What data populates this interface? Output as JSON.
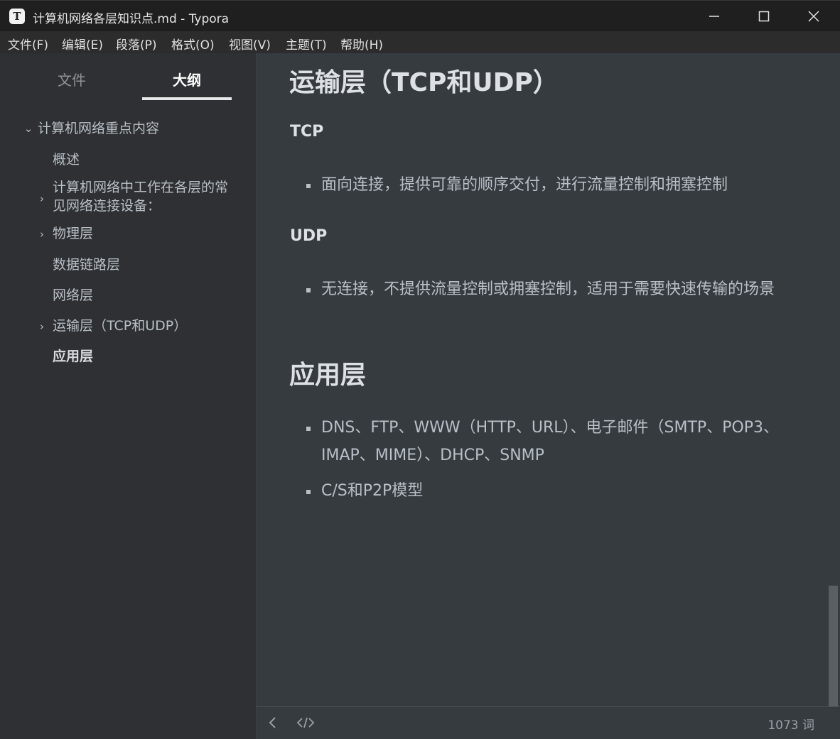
{
  "window": {
    "title": "计算机网络各层知识点.md - Typora",
    "app_icon_letter": "T"
  },
  "menu": [
    "文件(F)",
    "编辑(E)",
    "段落(P)",
    "格式(O)",
    "视图(V)",
    "主题(T)",
    "帮助(H)"
  ],
  "sidebar": {
    "tabs": [
      "文件",
      "大纲"
    ],
    "active_tab": "大纲",
    "outline": [
      {
        "label": "计算机网络重点内容",
        "expander": "expanded"
      },
      {
        "label": "概述",
        "expander": "none"
      },
      {
        "label": "计算机网络中工作在各层的常见网络连接设备：",
        "expander": "collapsed"
      },
      {
        "label": "物理层",
        "expander": "collapsed"
      },
      {
        "label": "数据链路层",
        "expander": "none"
      },
      {
        "label": "网络层",
        "expander": "none"
      },
      {
        "label": "运输层（TCP和UDP）",
        "expander": "collapsed"
      },
      {
        "label": "应用层",
        "expander": "none",
        "active": true
      }
    ]
  },
  "document": {
    "h1_transport": "运输层（TCP和UDP）",
    "h3_tcp": "TCP",
    "tcp_item": "面向连接，提供可靠的顺序交付，进行流量控制和拥塞控制",
    "h3_udp": "UDP",
    "udp_item": "无连接，不提供流量控制或拥塞控制，适用于需要快速传输的场景",
    "h1_app": "应用层",
    "app_items": [
      "DNS、FTP、WWW（HTTP、URL）、电子邮件（SMTP、POP3、IMAP、MIME）、DHCP、SNMP",
      "C/S和P2P模型"
    ]
  },
  "statusbar": {
    "word_count": "1073 词"
  },
  "icons": {
    "minimize": "minimize-icon",
    "maximize": "maximize-icon",
    "close": "close-icon",
    "sidebar_toggle": "chevron-left-icon",
    "source_mode": "code-icon"
  },
  "colors": {
    "background": "#363B40",
    "sidebar": "#2E3033",
    "titlebar": "#1F1F1F",
    "text": "#B8BFC6",
    "heading": "#DDE1E5"
  }
}
